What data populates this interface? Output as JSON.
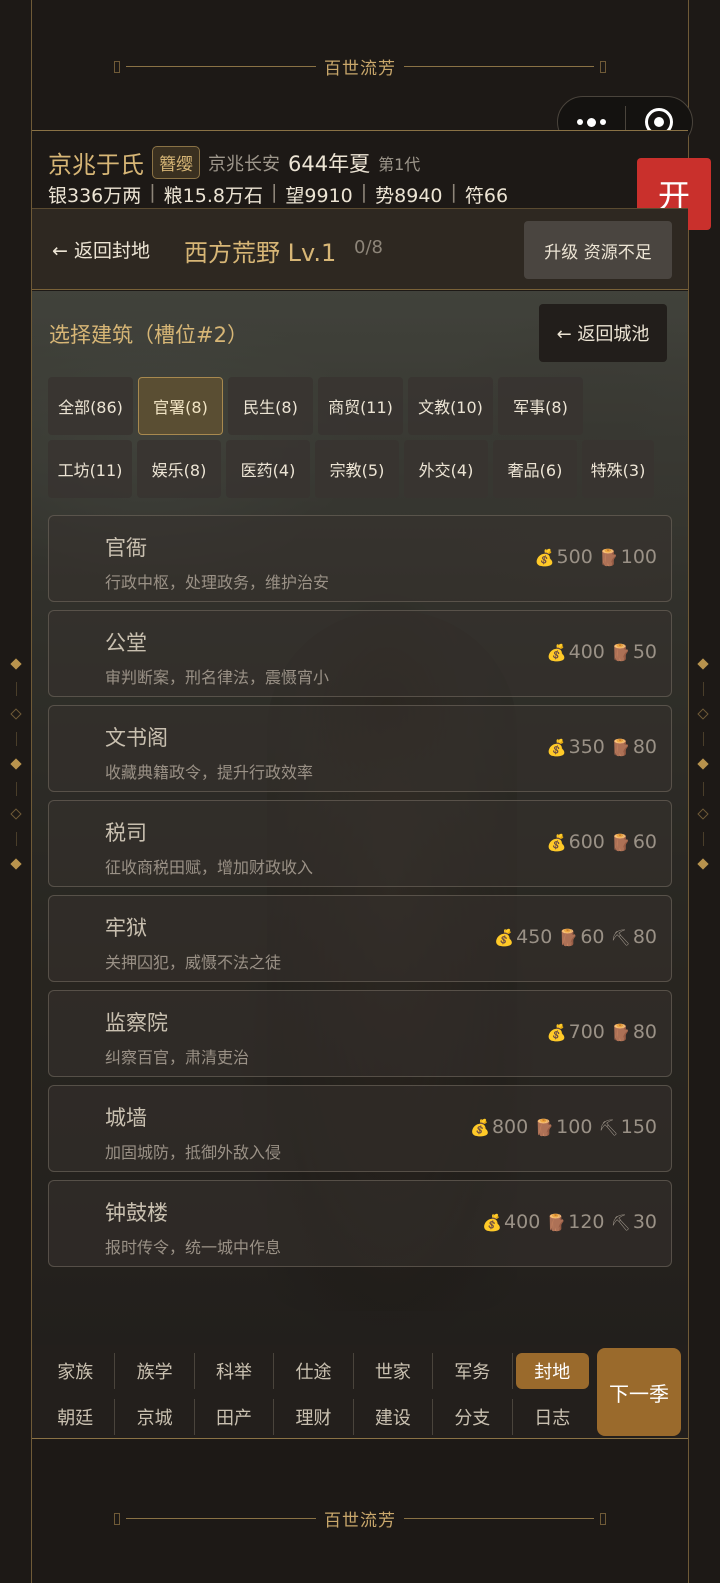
{
  "banner_title": "百世流芳",
  "header": {
    "clan": "京兆于氏",
    "rank": "簪缨",
    "place": "京兆长安",
    "year": "644年夏",
    "generation": "第1代",
    "silver": "银336万两",
    "grain": "粮15.8万石",
    "prestige": "望9910",
    "power": "势8940",
    "token": "符66",
    "sep": "|"
  },
  "open_button": "开",
  "fief": {
    "back_label": "← 返回封地",
    "name": "西方荒野 Lv.1",
    "slots": "0/8",
    "upgrade_label": "升级 资源不足"
  },
  "build": {
    "title": "选择建筑（槽位#2）",
    "return_label": "← 返回城池",
    "tabs_row1": [
      "全部(86)",
      "官署(8)",
      "民生(8)",
      "商贸(11)",
      "文教(10)",
      "军事(8)"
    ],
    "tabs_row2": [
      "工坊(11)",
      "娱乐(8)",
      "医药(4)",
      "宗教(5)",
      "外交(4)",
      "奢品(6)",
      "特殊(3)"
    ],
    "active_tab": "官署(8)",
    "buildings": [
      {
        "name": "官衙",
        "desc": "行政中枢，处理政务，维护治安",
        "silver": "500",
        "wood": "100",
        "iron": ""
      },
      {
        "name": "公堂",
        "desc": "审判断案，刑名律法，震慑宵小",
        "silver": "400",
        "wood": "50",
        "iron": ""
      },
      {
        "name": "文书阁",
        "desc": "收藏典籍政令，提升行政效率",
        "silver": "350",
        "wood": "80",
        "iron": ""
      },
      {
        "name": "税司",
        "desc": "征收商税田赋，增加财政收入",
        "silver": "600",
        "wood": "60",
        "iron": ""
      },
      {
        "name": "牢狱",
        "desc": "关押囚犯，威慑不法之徒",
        "silver": "450",
        "wood": "60",
        "iron": "80"
      },
      {
        "name": "监察院",
        "desc": "纠察百官，肃清吏治",
        "silver": "700",
        "wood": "80",
        "iron": ""
      },
      {
        "name": "城墙",
        "desc": "加固城防，抵御外敌入侵",
        "silver": "800",
        "wood": "100",
        "iron": "150"
      },
      {
        "name": "钟鼓楼",
        "desc": "报时传令，统一城中作息",
        "silver": "400",
        "wood": "120",
        "iron": "30"
      }
    ]
  },
  "icons": {
    "silver": "money-bag-icon",
    "wood": "log-icon",
    "iron": "pickaxe-icon"
  },
  "nav": {
    "row1": [
      "家族",
      "族学",
      "科举",
      "仕途",
      "世家",
      "军务",
      "封地"
    ],
    "row2": [
      "朝廷",
      "京城",
      "田产",
      "理财",
      "建设",
      "分支",
      "日志"
    ],
    "active": "封地",
    "next_season": "下一季"
  },
  "colors": {
    "accent_gold": "#d7b676",
    "active_brown": "#9a6a2c",
    "open_red": "#c9302c"
  }
}
